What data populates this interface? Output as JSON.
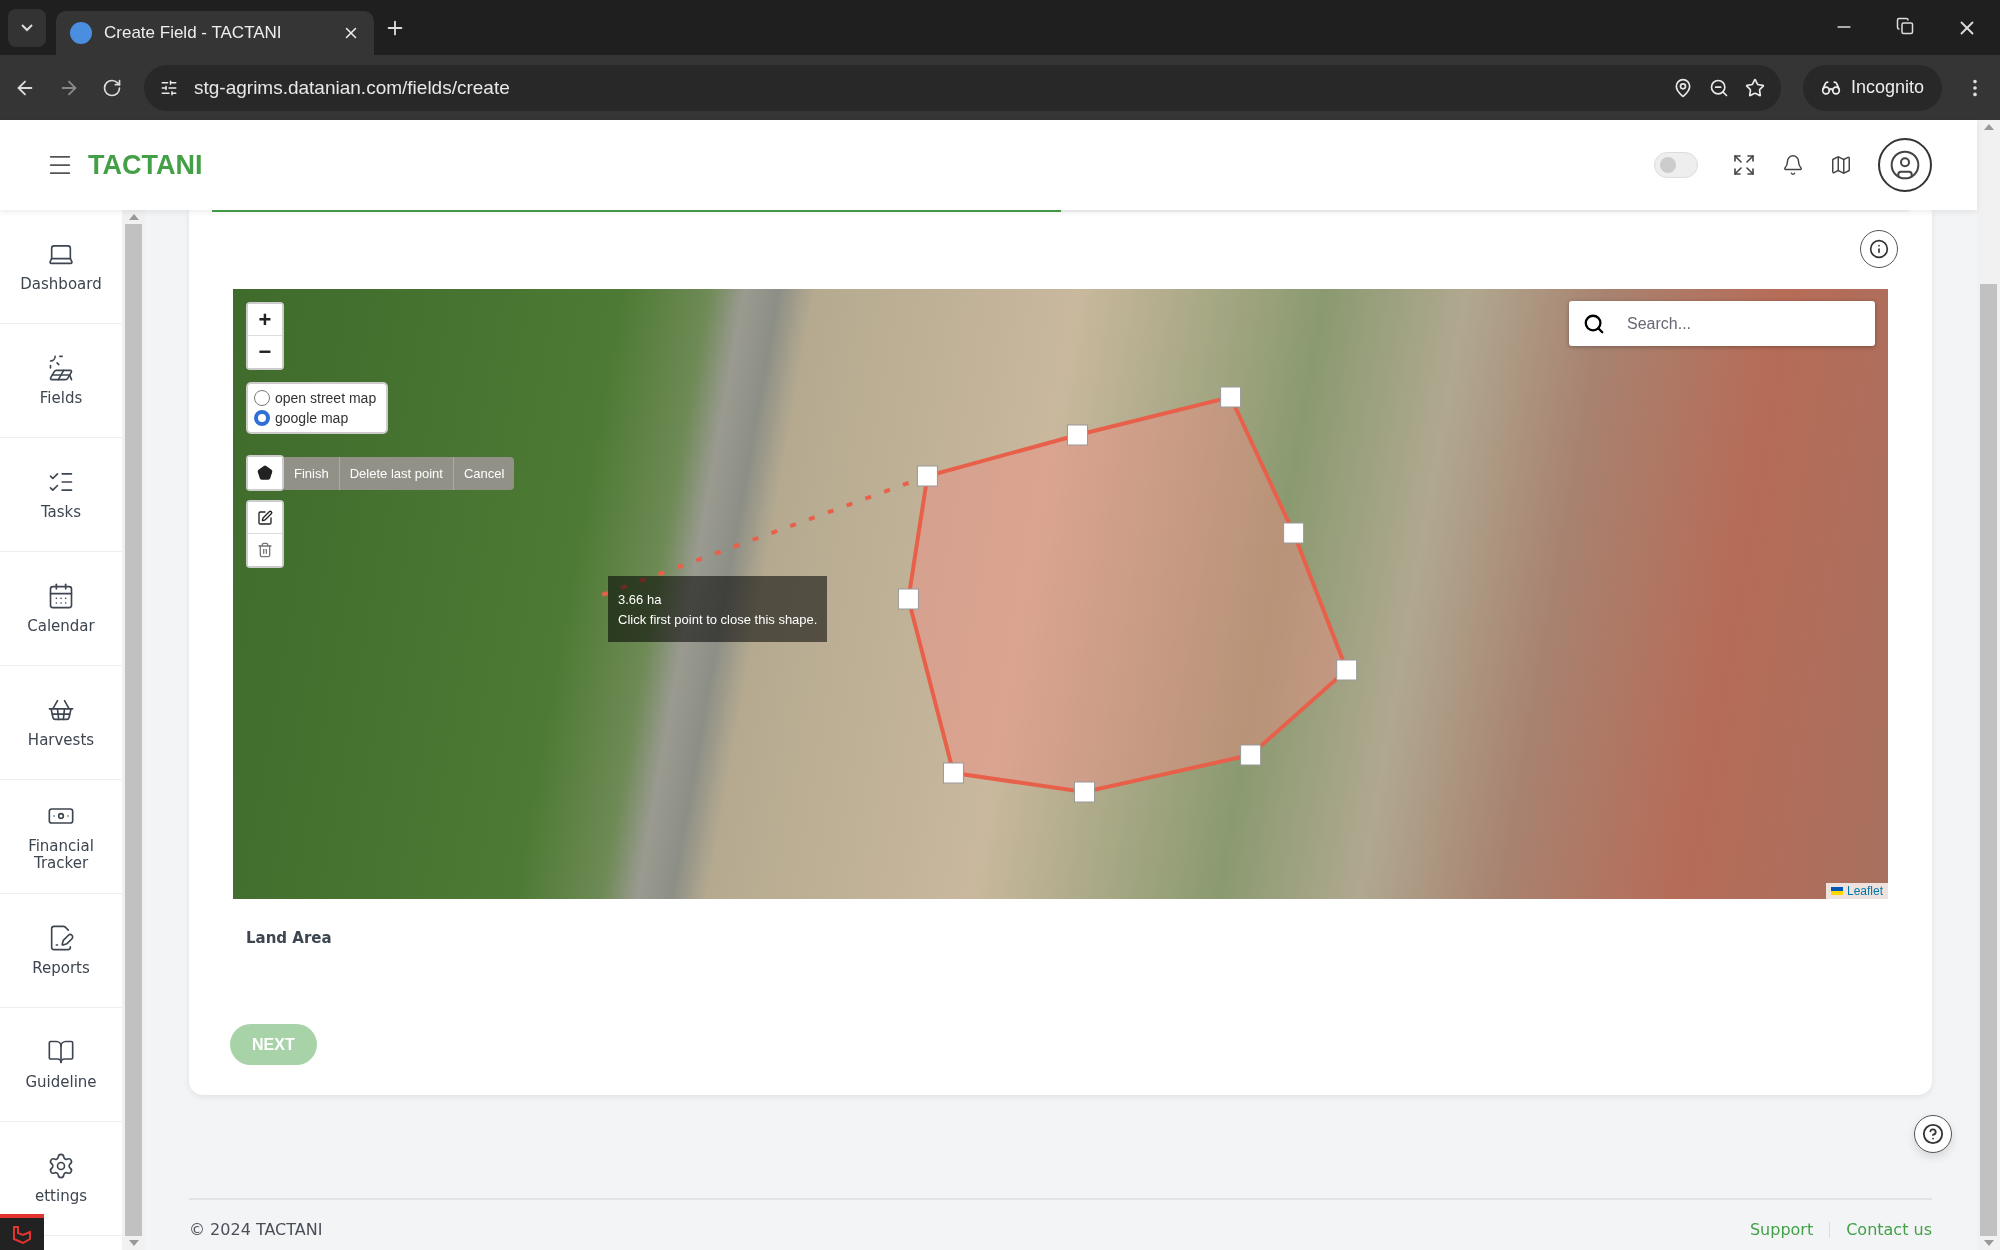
{
  "browser": {
    "tab_title": "Create Field - TACTANI",
    "url": "stg-agrims.datanian.com/fields/create",
    "profile_label": "Incognito"
  },
  "header": {
    "brand": "TACTANI",
    "theme_toggle": {
      "on": false
    }
  },
  "sidebar": {
    "items": [
      {
        "label": "Dashboard"
      },
      {
        "label": "Fields"
      },
      {
        "label": "Tasks"
      },
      {
        "label": "Calendar"
      },
      {
        "label": "Harvests"
      },
      {
        "label": "Financial Tracker"
      },
      {
        "label": "Reports"
      },
      {
        "label": "Guideline"
      },
      {
        "label": "ettings"
      }
    ]
  },
  "progress": {
    "level": 0.5
  },
  "map": {
    "zoom_in": "+",
    "zoom_out": "−",
    "layers": [
      {
        "label": "open street map",
        "selected": false
      },
      {
        "label": "google map",
        "selected": true
      }
    ],
    "draw_actions": [
      "Finish",
      "Delete last point",
      "Cancel"
    ],
    "tooltip": {
      "area": "3.66 ha",
      "hint": "Click first point to close this shape."
    },
    "search": {
      "placeholder": "Search..."
    },
    "attribution": "Leaflet"
  },
  "form": {
    "land_area_label": "Land Area",
    "next_button": {
      "label": "NEXT",
      "disabled": true
    }
  },
  "footer": {
    "copyright": "© 2024 TACTANI",
    "links": [
      "Support",
      "Contact us"
    ]
  }
}
